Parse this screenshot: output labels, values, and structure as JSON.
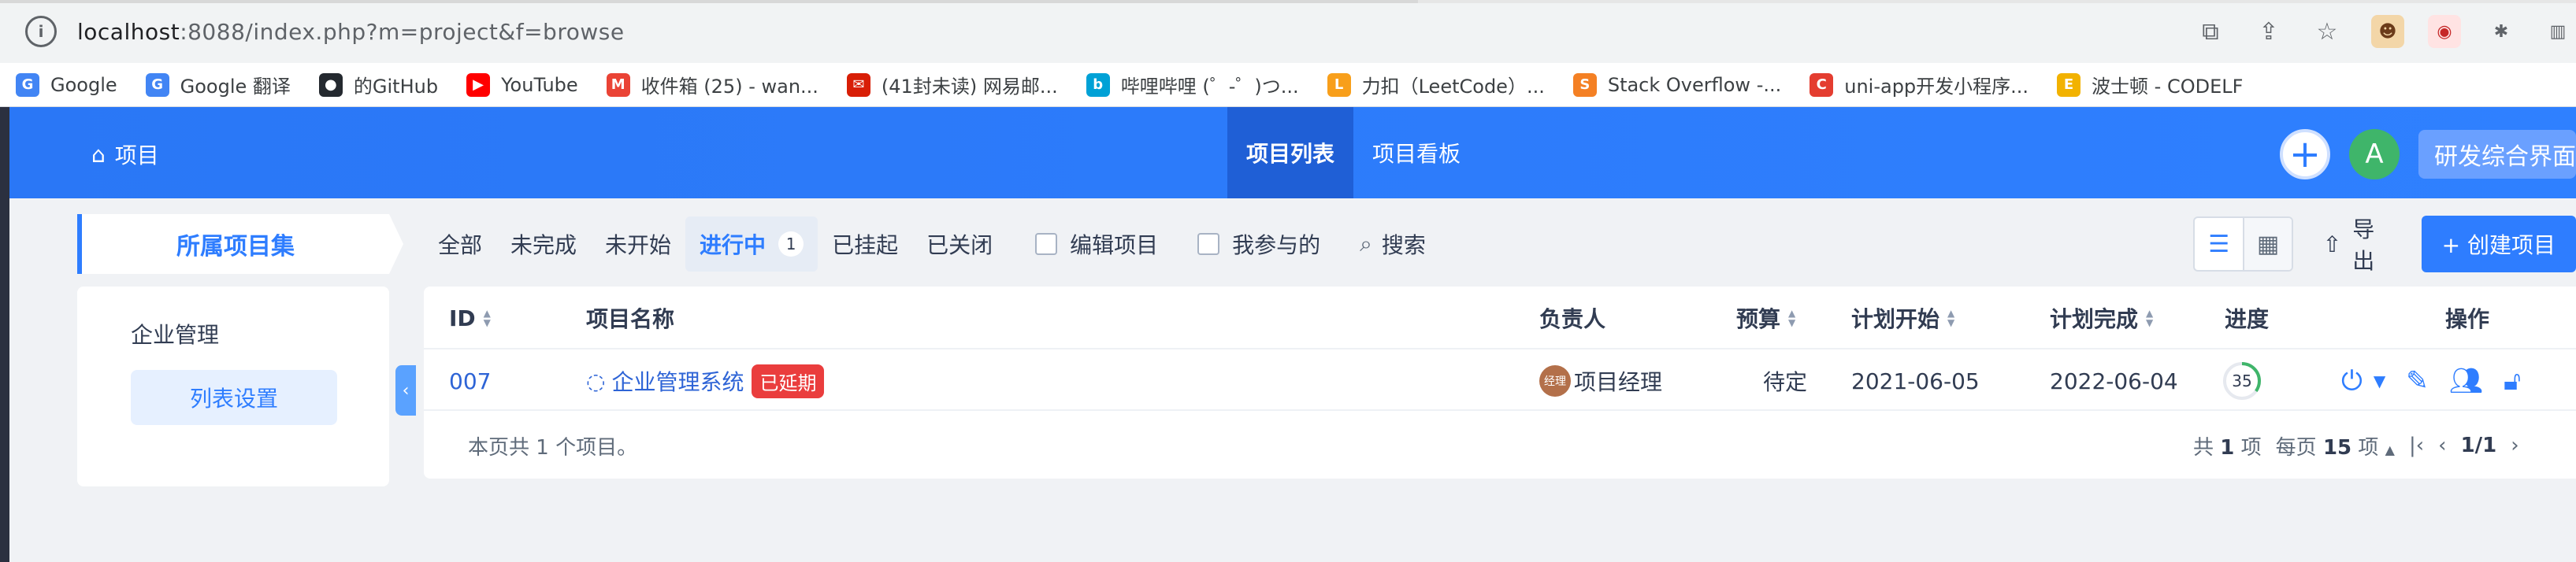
{
  "browser": {
    "url_host": "localhost",
    "url_path": ":8088/index.php?m=project&f=browse",
    "bookmarks": [
      {
        "label": "Google",
        "icon": "G",
        "color": "#4285f4"
      },
      {
        "label": "Google 翻译",
        "icon": "G",
        "color": "#4285f4"
      },
      {
        "label": "的GitHub",
        "icon": "●",
        "color": "#24292f"
      },
      {
        "label": "YouTube",
        "icon": "▶",
        "color": "#ff0000"
      },
      {
        "label": "收件箱 (25) - wan...",
        "icon": "M",
        "color": "#ea4335"
      },
      {
        "label": "(41封未读) 网易邮...",
        "icon": "✉",
        "color": "#d81e06"
      },
      {
        "label": "哔哩哔哩 (゜-゜)つ...",
        "icon": "b",
        "color": "#00a1d6"
      },
      {
        "label": "力扣（LeetCode）...",
        "icon": "L",
        "color": "#f89f1b"
      },
      {
        "label": "Stack Overflow -...",
        "icon": "S",
        "color": "#f48024"
      },
      {
        "label": "uni-app开发小程序...",
        "icon": "C",
        "color": "#e43d30"
      },
      {
        "label": "波士顿 - CODELF",
        "icon": "E",
        "color": "#f2b200"
      }
    ]
  },
  "topnav": {
    "project_label": "项目",
    "tabs": [
      {
        "label": "项目列表",
        "active": true
      },
      {
        "label": "项目看板",
        "active": false
      }
    ],
    "plus": "+",
    "avatar_letter": "A",
    "system_label": "研发综合界面"
  },
  "sidebar": {
    "header": "所属项目集",
    "items": [
      {
        "label": "企业管理"
      }
    ],
    "settings_button": "列表设置"
  },
  "filters": {
    "items": [
      {
        "label": "全部"
      },
      {
        "label": "未完成"
      },
      {
        "label": "未开始"
      },
      {
        "label": "进行中",
        "count": "1",
        "active": true
      },
      {
        "label": "已挂起"
      },
      {
        "label": "已关闭"
      }
    ],
    "edit_project": "编辑项目",
    "my_involved": "我参与的",
    "search": "搜索"
  },
  "tools": {
    "export": "导出",
    "create": "+ 创建项目"
  },
  "table": {
    "columns": {
      "id": "ID",
      "name": "项目名称",
      "owner": "负责人",
      "budget": "预算",
      "plan_start": "计划开始",
      "plan_end": "计划完成",
      "progress": "进度",
      "actions": "操作"
    },
    "rows": [
      {
        "id": "007",
        "name": "企业管理系统",
        "status_tag": "已延期",
        "owner_avatar": "经理",
        "owner": "项目经理",
        "budget": "待定",
        "plan_start": "2021-06-05",
        "plan_end": "2022-06-04",
        "progress": "35"
      }
    ],
    "footer_summary": "本页共 1 个项目。",
    "total_prefix": "共",
    "total_count": "1",
    "total_suffix": "项",
    "per_page_prefix": "每页",
    "per_page": "15",
    "per_page_suffix": "项",
    "page_info": "1/1"
  },
  "colors": {
    "brand_blue": "#2e7dff",
    "delay_red": "#ea3d3d",
    "progress_green": "#3fb56a"
  }
}
